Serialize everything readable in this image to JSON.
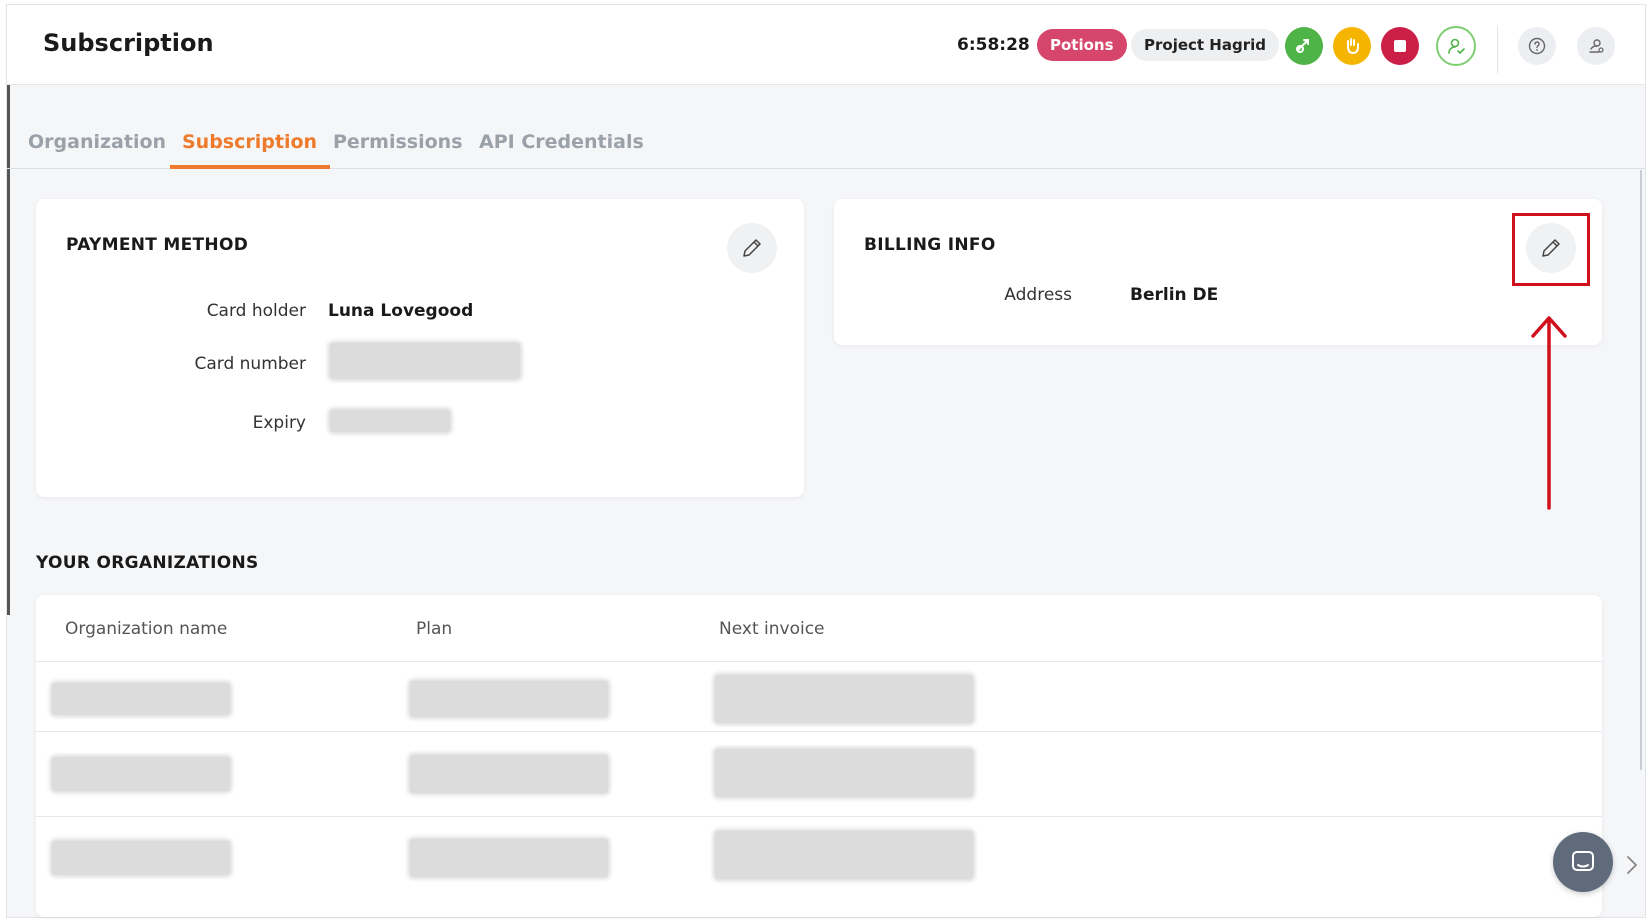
{
  "header": {
    "title": "Subscription",
    "timer": "6:58:28",
    "badge_primary": "Potions",
    "badge_project": "Project Hagrid",
    "colors": {
      "green": "#4fb447",
      "yellow": "#f4b400",
      "red": "#cc1f48",
      "potions": "#d6456b",
      "accent": "#ee7b2c"
    }
  },
  "tabs": [
    {
      "label": "Organization",
      "active": false
    },
    {
      "label": "Subscription",
      "active": true
    },
    {
      "label": "Permissions",
      "active": false
    },
    {
      "label": "API Credentials",
      "active": false
    }
  ],
  "payment": {
    "title": "PAYMENT METHOD",
    "card_holder_label": "Card holder",
    "card_holder_value": "Luna Lovegood",
    "card_number_label": "Card number",
    "expiry_label": "Expiry"
  },
  "billing": {
    "title": "BILLING INFO",
    "address_label": "Address",
    "address_value": "Berlin DE"
  },
  "organizations": {
    "title": "YOUR ORGANIZATIONS",
    "columns": [
      "Organization name",
      "Plan",
      "Next invoice"
    ]
  },
  "icons": {
    "edit": "pencil-icon",
    "chat": "chat-icon",
    "help": "question-icon",
    "user": "user-icon",
    "admin": "admin-settings-icon"
  }
}
